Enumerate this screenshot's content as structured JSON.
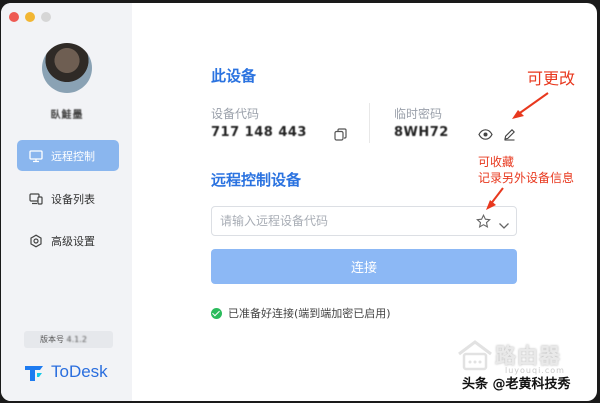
{
  "sidebar": {
    "username": "臥鮭墨",
    "nav": [
      {
        "label": "远程控制",
        "icon": "monitor-icon",
        "active": true
      },
      {
        "label": "设备列表",
        "icon": "devices-icon",
        "active": false
      },
      {
        "label": "高级设置",
        "icon": "gear-icon",
        "active": false
      }
    ],
    "version_label": "版本号",
    "version_value": "4.1.2",
    "brand": "ToDesk"
  },
  "this_device": {
    "title": "此设备",
    "code_label": "设备代码",
    "code_value": "717 148 443",
    "password_label": "临时密码",
    "password_value": "8WH72"
  },
  "remote": {
    "title": "远程控制设备",
    "input_placeholder": "请输入远程设备代码",
    "connect_label": "连接",
    "status_text": "已准备好连接(端到端加密已启用)"
  },
  "annotations": {
    "editable": "可更改",
    "favorite_line1": "可收藏",
    "favorite_line2": "记录另外设备信息"
  },
  "watermark": {
    "title": "路由器",
    "subtitle": "luyouqi.com",
    "handle": "头条 @老黄科技秀"
  },
  "colors": {
    "accent": "#2b73e0",
    "nav_active": "#8ab6ee",
    "connect_button": "#8cb8f5",
    "annotation": "#e8381e",
    "status_ok": "#2bbb5c"
  }
}
